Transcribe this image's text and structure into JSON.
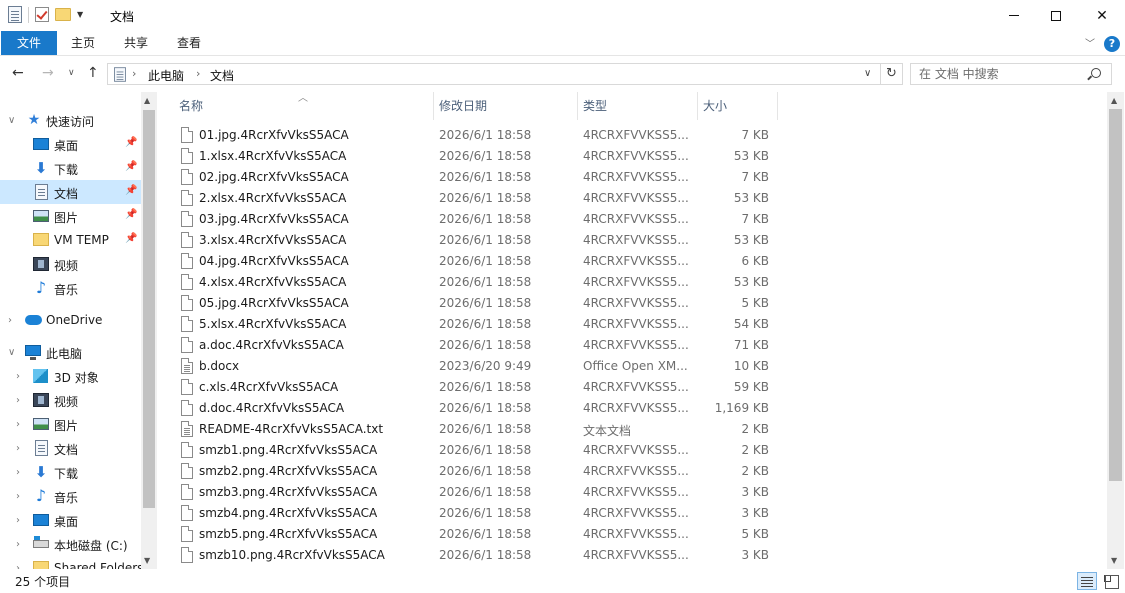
{
  "window": {
    "title": "文档"
  },
  "ribbon": {
    "tabs": [
      "文件",
      "主页",
      "共享",
      "查看"
    ],
    "help_label": "?"
  },
  "address": {
    "breadcrumbs": [
      "此电脑",
      "文档"
    ]
  },
  "search": {
    "placeholder": "在 文档 中搜索"
  },
  "navigation": {
    "quick_access": "快速访问",
    "quick_items": [
      "桌面",
      "下载",
      "文档",
      "图片",
      "VM TEMP",
      "视频",
      "音乐"
    ],
    "onedrive": "OneDrive",
    "this_pc": "此电脑",
    "pc_items": [
      "3D 对象",
      "视频",
      "图片",
      "文档",
      "下载",
      "音乐",
      "桌面",
      "本地磁盘 (C:)",
      "Shared Folders"
    ],
    "selected": "文档"
  },
  "columns": {
    "name": "名称",
    "date": "修改日期",
    "type": "类型",
    "size": "大小"
  },
  "files": [
    {
      "name": "01.jpg.4RcrXfvVksS5ACA",
      "date": "2026/6/1 18:58",
      "type": "4RCRXFVVKSS5...",
      "size": "7 KB"
    },
    {
      "name": "1.xlsx.4RcrXfvVksS5ACA",
      "date": "2026/6/1 18:58",
      "type": "4RCRXFVVKSS5...",
      "size": "53 KB"
    },
    {
      "name": "02.jpg.4RcrXfvVksS5ACA",
      "date": "2026/6/1 18:58",
      "type": "4RCRXFVVKSS5...",
      "size": "7 KB"
    },
    {
      "name": "2.xlsx.4RcrXfvVksS5ACA",
      "date": "2026/6/1 18:58",
      "type": "4RCRXFVVKSS5...",
      "size": "53 KB"
    },
    {
      "name": "03.jpg.4RcrXfvVksS5ACA",
      "date": "2026/6/1 18:58",
      "type": "4RCRXFVVKSS5...",
      "size": "7 KB"
    },
    {
      "name": "3.xlsx.4RcrXfvVksS5ACA",
      "date": "2026/6/1 18:58",
      "type": "4RCRXFVVKSS5...",
      "size": "53 KB"
    },
    {
      "name": "04.jpg.4RcrXfvVksS5ACA",
      "date": "2026/6/1 18:58",
      "type": "4RCRXFVVKSS5...",
      "size": "6 KB"
    },
    {
      "name": "4.xlsx.4RcrXfvVksS5ACA",
      "date": "2026/6/1 18:58",
      "type": "4RCRXFVVKSS5...",
      "size": "53 KB"
    },
    {
      "name": "05.jpg.4RcrXfvVksS5ACA",
      "date": "2026/6/1 18:58",
      "type": "4RCRXFVVKSS5...",
      "size": "5 KB"
    },
    {
      "name": "5.xlsx.4RcrXfvVksS5ACA",
      "date": "2026/6/1 18:58",
      "type": "4RCRXFVVKSS5...",
      "size": "54 KB"
    },
    {
      "name": "a.doc.4RcrXfvVksS5ACA",
      "date": "2026/6/1 18:58",
      "type": "4RCRXFVVKSS5...",
      "size": "71 KB"
    },
    {
      "name": "b.docx",
      "date": "2023/6/20 9:49",
      "type": "Office Open XM...",
      "size": "10 KB"
    },
    {
      "name": "c.xls.4RcrXfvVksS5ACA",
      "date": "2026/6/1 18:58",
      "type": "4RCRXFVVKSS5...",
      "size": "59 KB"
    },
    {
      "name": "d.doc.4RcrXfvVksS5ACA",
      "date": "2026/6/1 18:58",
      "type": "4RCRXFVVKSS5...",
      "size": "1,169 KB"
    },
    {
      "name": "README-4RcrXfvVksS5ACA.txt",
      "date": "2026/6/1 18:58",
      "type": "文本文档",
      "size": "2 KB"
    },
    {
      "name": "smzb1.png.4RcrXfvVksS5ACA",
      "date": "2026/6/1 18:58",
      "type": "4RCRXFVVKSS5...",
      "size": "2 KB"
    },
    {
      "name": "smzb2.png.4RcrXfvVksS5ACA",
      "date": "2026/6/1 18:58",
      "type": "4RCRXFVVKSS5...",
      "size": "2 KB"
    },
    {
      "name": "smzb3.png.4RcrXfvVksS5ACA",
      "date": "2026/6/1 18:58",
      "type": "4RCRXFVVKSS5...",
      "size": "3 KB"
    },
    {
      "name": "smzb4.png.4RcrXfvVksS5ACA",
      "date": "2026/6/1 18:58",
      "type": "4RCRXFVVKSS5...",
      "size": "3 KB"
    },
    {
      "name": "smzb5.png.4RcrXfvVksS5ACA",
      "date": "2026/6/1 18:58",
      "type": "4RCRXFVVKSS5...",
      "size": "5 KB"
    },
    {
      "name": "smzb10.png.4RcrXfvVksS5ACA",
      "date": "2026/6/1 18:58",
      "type": "4RCRXFVVKSS5...",
      "size": "3 KB"
    }
  ],
  "status": {
    "item_count": "25 个项目"
  },
  "colors": {
    "accent": "#1979ca",
    "selection": "#cce8ff",
    "header_text": "#4c607a"
  }
}
